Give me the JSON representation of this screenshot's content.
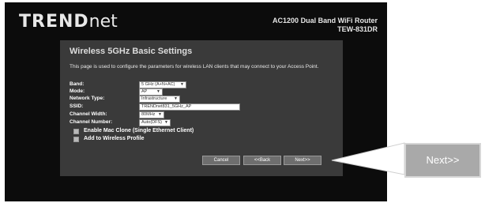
{
  "header": {
    "logo_main": "TREND",
    "logo_net": "net",
    "product_name": "AC1200 Dual Band WiFi Router",
    "model": "TEW-831DR"
  },
  "panel": {
    "title": "Wireless 5GHz Basic Settings",
    "description": "This page is used to configure the parameters for wireless LAN clients that may connect to your Access Point."
  },
  "fields": {
    "band": {
      "label": "Band:",
      "value": "5 GHz (A+N+AC)"
    },
    "mode": {
      "label": "Mode:",
      "value": "AP"
    },
    "network_type": {
      "label": "Network Type:",
      "value": "Infrastructure"
    },
    "ssid": {
      "label": "SSID:",
      "value": "TRENDnet831_5GHz_AP"
    },
    "channel_width": {
      "label": "Channel Width:",
      "value": "80MHz"
    },
    "channel_number": {
      "label": "Channel Number:",
      "value": "Auto(DFS)"
    }
  },
  "checkboxes": {
    "mac_clone": "Enable Mac Clone (Single Ethernet Client)",
    "wireless_profile": "Add to Wireless Profile"
  },
  "buttons": {
    "cancel": "Cancel",
    "back": "<<Back",
    "next": "Next>>"
  },
  "callout": {
    "next": "Next>>"
  },
  "colors": {
    "frame_bg": "#0c0c0c",
    "panel_bg": "#3a3a3a",
    "button_bg": "#6e6e6e",
    "callout_bg": "#a9a9a9"
  }
}
